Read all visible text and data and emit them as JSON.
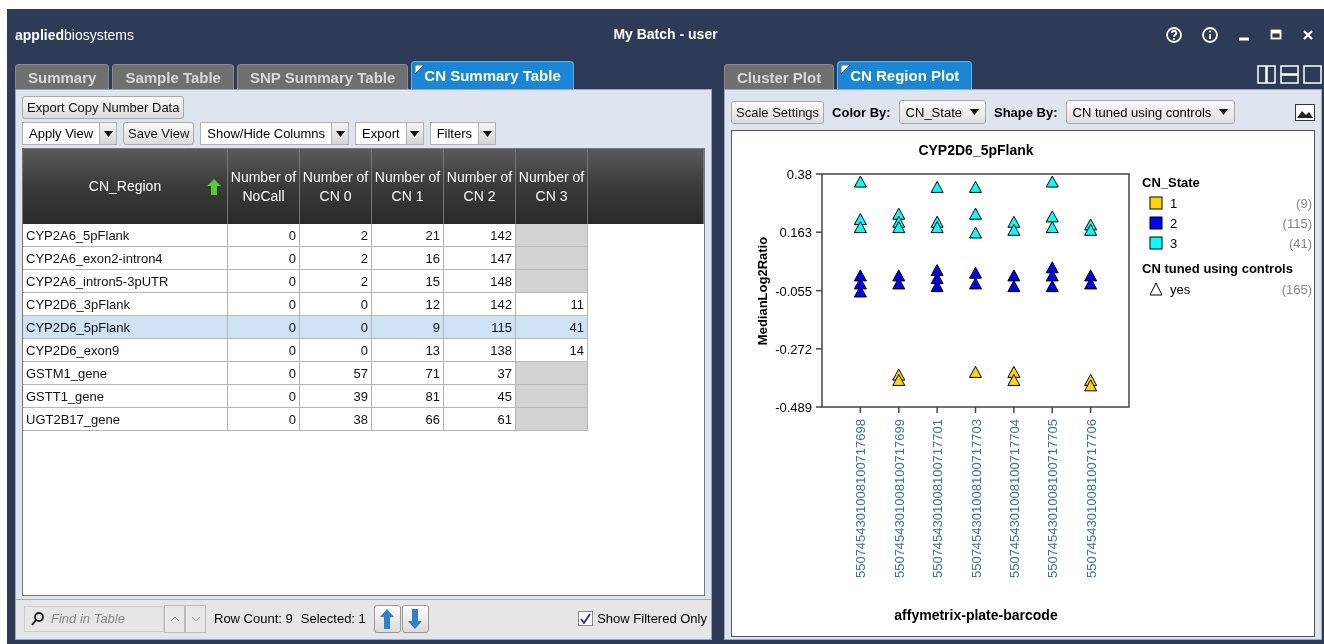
{
  "window": {
    "logo": "**applied**biosystems",
    "title": "My Batch - user"
  },
  "left_panel": {
    "tabs": [
      {
        "label": "Summary",
        "selected": false
      },
      {
        "label": "Sample Table",
        "selected": false
      },
      {
        "label": "SNP Summary Table",
        "selected": false
      },
      {
        "label": "CN Summary Table",
        "selected": true
      }
    ],
    "export_button": "Export Copy Number Data",
    "toolbar": [
      {
        "kind": "dropdown",
        "label": "Apply View"
      },
      {
        "kind": "button",
        "label": "Save View"
      },
      {
        "kind": "dropdown",
        "label": "Show/Hide Columns"
      },
      {
        "kind": "dropdown",
        "label": "Export"
      },
      {
        "kind": "dropdown",
        "label": "Filters"
      }
    ],
    "table": {
      "columns": [
        {
          "label": "CN_Region",
          "sorted": true
        },
        {
          "label": "Number of NoCall",
          "sorted": false
        },
        {
          "label": "Number of CN 0",
          "sorted": false
        },
        {
          "label": "Number of CN 1",
          "sorted": false
        },
        {
          "label": "Number of CN 2",
          "sorted": false
        },
        {
          "label": "Number of CN 3",
          "sorted": false
        }
      ],
      "rows": [
        {
          "selected": false,
          "cells": [
            "CYP2A6_5pFlank",
            "0",
            "2",
            "21",
            "142",
            null
          ]
        },
        {
          "selected": false,
          "cells": [
            "CYP2A6_exon2-intron4",
            "0",
            "2",
            "16",
            "147",
            null
          ]
        },
        {
          "selected": false,
          "cells": [
            "CYP2A6_intron5-3pUTR",
            "0",
            "2",
            "15",
            "148",
            null
          ]
        },
        {
          "selected": false,
          "cells": [
            "CYP2D6_3pFlank",
            "0",
            "0",
            "12",
            "142",
            "11"
          ]
        },
        {
          "selected": true,
          "cells": [
            "CYP2D6_5pFlank",
            "0",
            "0",
            "9",
            "115",
            "41"
          ]
        },
        {
          "selected": false,
          "cells": [
            "CYP2D6_exon9",
            "0",
            "0",
            "13",
            "138",
            "14"
          ]
        },
        {
          "selected": false,
          "cells": [
            "GSTM1_gene",
            "0",
            "57",
            "71",
            "37",
            null
          ]
        },
        {
          "selected": false,
          "cells": [
            "GSTT1_gene",
            "0",
            "39",
            "81",
            "45",
            null
          ]
        },
        {
          "selected": false,
          "cells": [
            "UGT2B17_gene",
            "0",
            "38",
            "66",
            "61",
            null
          ]
        }
      ]
    },
    "footer": {
      "search_placeholder": "Find in Table",
      "row_count": "Row Count: 9",
      "selected_count": "Selected: 1",
      "show_filtered_only": {
        "label": "Show Filtered Only",
        "checked": true
      }
    }
  },
  "right_panel": {
    "tabs": [
      {
        "label": "Cluster Plot",
        "selected": false
      },
      {
        "label": "CN Region Plot",
        "selected": true
      }
    ],
    "scale_button": "Scale Settings",
    "color_by": {
      "label": "Color By:",
      "value": "CN_State"
    },
    "shape_by": {
      "label": "Shape By:",
      "value": "CN tuned using controls"
    },
    "plot": {
      "color_legend": {
        "title": "CN_State",
        "counts": [
          "(9)",
          "(115)",
          "(41)"
        ]
      },
      "shape_legend": {
        "title": "CN tuned using controls",
        "items": [
          {
            "label": "yes",
            "count": "(165)"
          }
        ]
      },
      "chart_data": {
        "type": "scatter",
        "title": "CYP2D6_5pFlank",
        "xlabel": "affymetrix-plate-barcode",
        "ylabel": "MedianLog2Ratio",
        "categories": [
          "5507454301008100717698",
          "5507454301008100717699",
          "5507454301008100717701",
          "5507454301008100717703",
          "5507454301008100717704",
          "5507454301008100717705",
          "5507454301008100717706"
        ],
        "ylim": [
          -0.489,
          0.38
        ],
        "yticks": [
          0.38,
          0.163,
          -0.055,
          -0.272,
          -0.489
        ],
        "legend": "right",
        "series": [
          {
            "name": "1",
            "color": "#ffd700",
            "values": [
              null,
              -0.37,
              null,
              -0.36,
              -0.36,
              null,
              -0.39
            ]
          },
          {
            "color": "#ffd700",
            "values": [
              null,
              -0.39,
              null,
              null,
              -0.39,
              null,
              -0.41
            ]
          },
          {
            "name": "2",
            "color": "#0000ff",
            "values": [
              0.0,
              0.0,
              0.02,
              0.01,
              0.0,
              0.03,
              0.0
            ]
          },
          {
            "color": "#0000ff",
            "values": [
              -0.03,
              -0.03,
              -0.01,
              -0.03,
              -0.04,
              0.0,
              -0.03
            ]
          },
          {
            "color": "#0000ff",
            "values": [
              -0.06,
              null,
              -0.04,
              null,
              null,
              -0.04,
              null
            ]
          },
          {
            "name": "3",
            "color": "#00ffff",
            "values": [
              0.35,
              0.23,
              0.33,
              0.33,
              0.2,
              0.35,
              0.19
            ]
          },
          {
            "color": "#00ffff",
            "values": [
              0.21,
              0.2,
              0.2,
              0.23,
              0.17,
              0.22,
              0.17
            ]
          },
          {
            "color": "#00ffff",
            "values": [
              0.18,
              0.18,
              0.18,
              0.16,
              null,
              0.18,
              null
            ]
          }
        ]
      }
    }
  }
}
